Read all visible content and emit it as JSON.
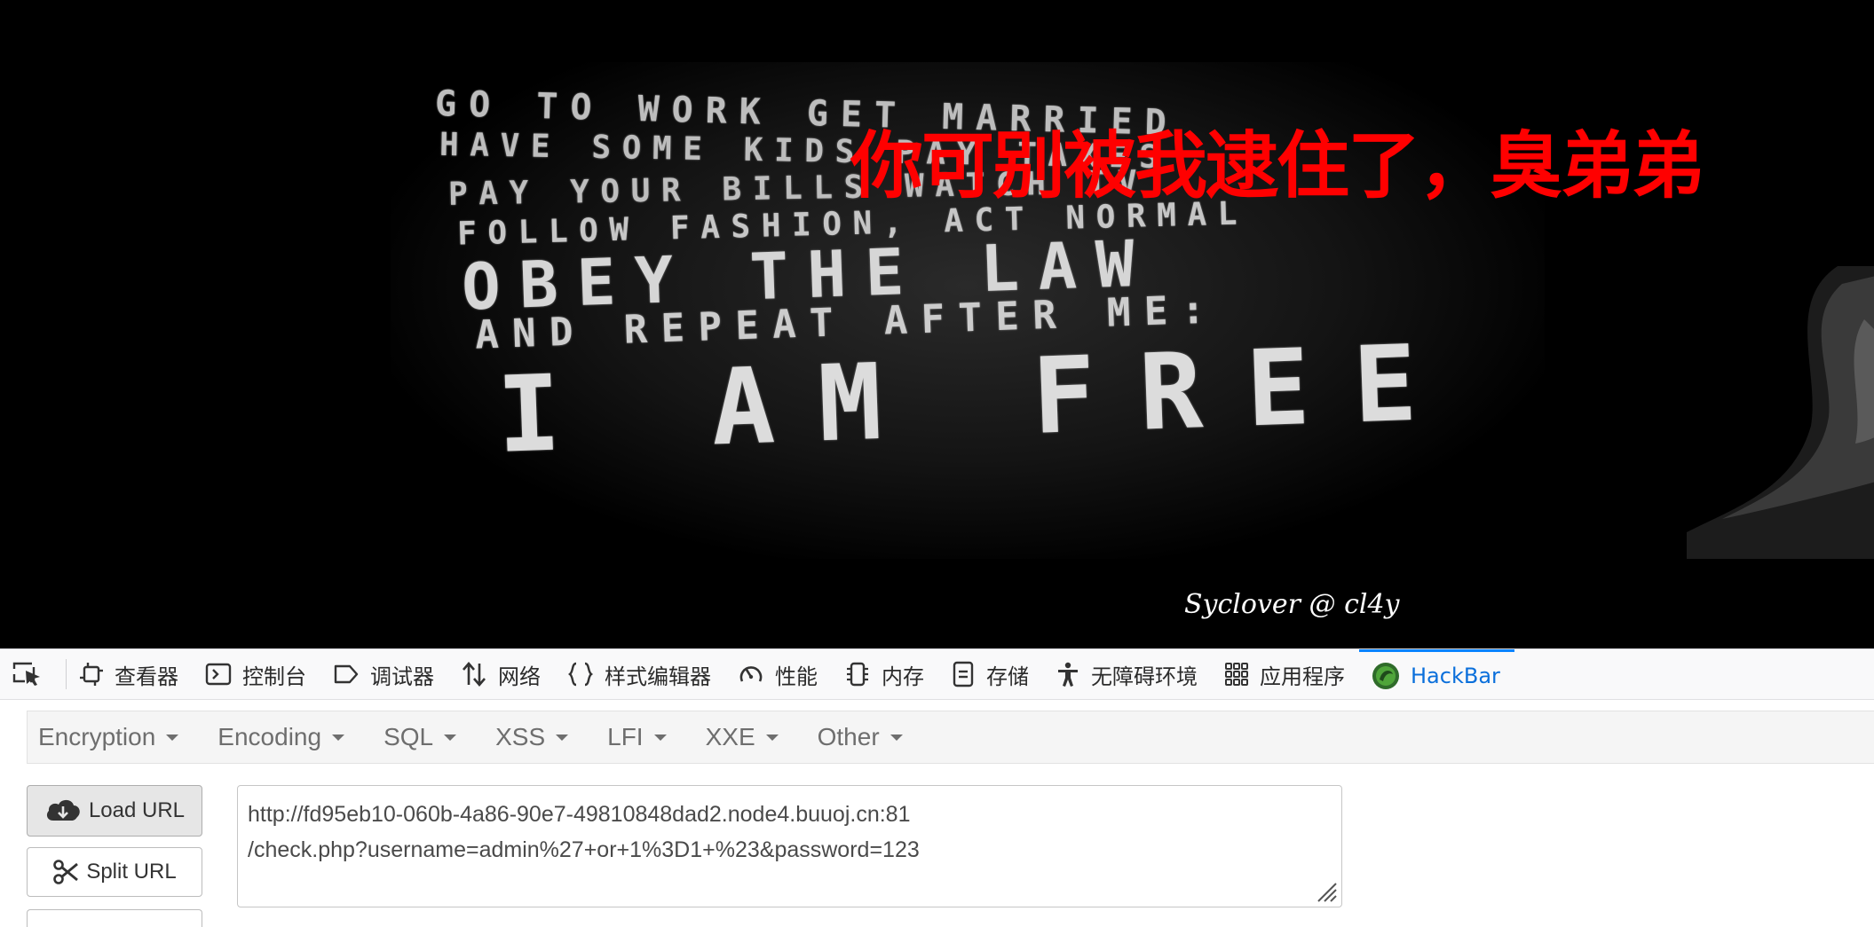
{
  "page": {
    "red_title": "你可别被我逮住了，臭弟弟",
    "signature": "Syclover @ cl4y",
    "poster_lines": [
      "GO TO WORK  GET MARRIED",
      "HAVE SOME KIDS  PAY TAXES",
      "PAY YOUR BILLS  WATCH TV",
      "FOLLOW FASHION, ACT NORMAL",
      "OBEY THE LAW",
      "AND REPEAT AFTER ME:",
      "I AM FREE"
    ]
  },
  "devtools": {
    "tabs": [
      {
        "label": "查看器",
        "icon": "inspector-icon"
      },
      {
        "label": "控制台",
        "icon": "console-icon"
      },
      {
        "label": "调试器",
        "icon": "debugger-icon"
      },
      {
        "label": "网络",
        "icon": "network-icon"
      },
      {
        "label": "样式编辑器",
        "icon": "style-editor-icon"
      },
      {
        "label": "性能",
        "icon": "performance-icon"
      },
      {
        "label": "内存",
        "icon": "memory-icon"
      },
      {
        "label": "存储",
        "icon": "storage-icon"
      },
      {
        "label": "无障碍环境",
        "icon": "accessibility-icon"
      },
      {
        "label": "应用程序",
        "icon": "application-icon"
      },
      {
        "label": "HackBar",
        "icon": "hackbar-icon"
      }
    ],
    "active_tab": "HackBar",
    "active_color": "#0a84ff"
  },
  "hackbar": {
    "menus": [
      "Encryption",
      "Encoding",
      "SQL",
      "XSS",
      "LFI",
      "XXE",
      "Other"
    ],
    "load_url_label": "Load URL",
    "split_url_label": "Split URL",
    "url_line_1": "http://fd95eb10-060b-4a86-90e7-49810848dad2.node4.buuoj.cn:81",
    "url_line_2": "/check.php?username=admin%27+or+1%3D1+%23&password=123"
  },
  "colors": {
    "title_red": "#ff0000",
    "page_background": "#000000"
  }
}
